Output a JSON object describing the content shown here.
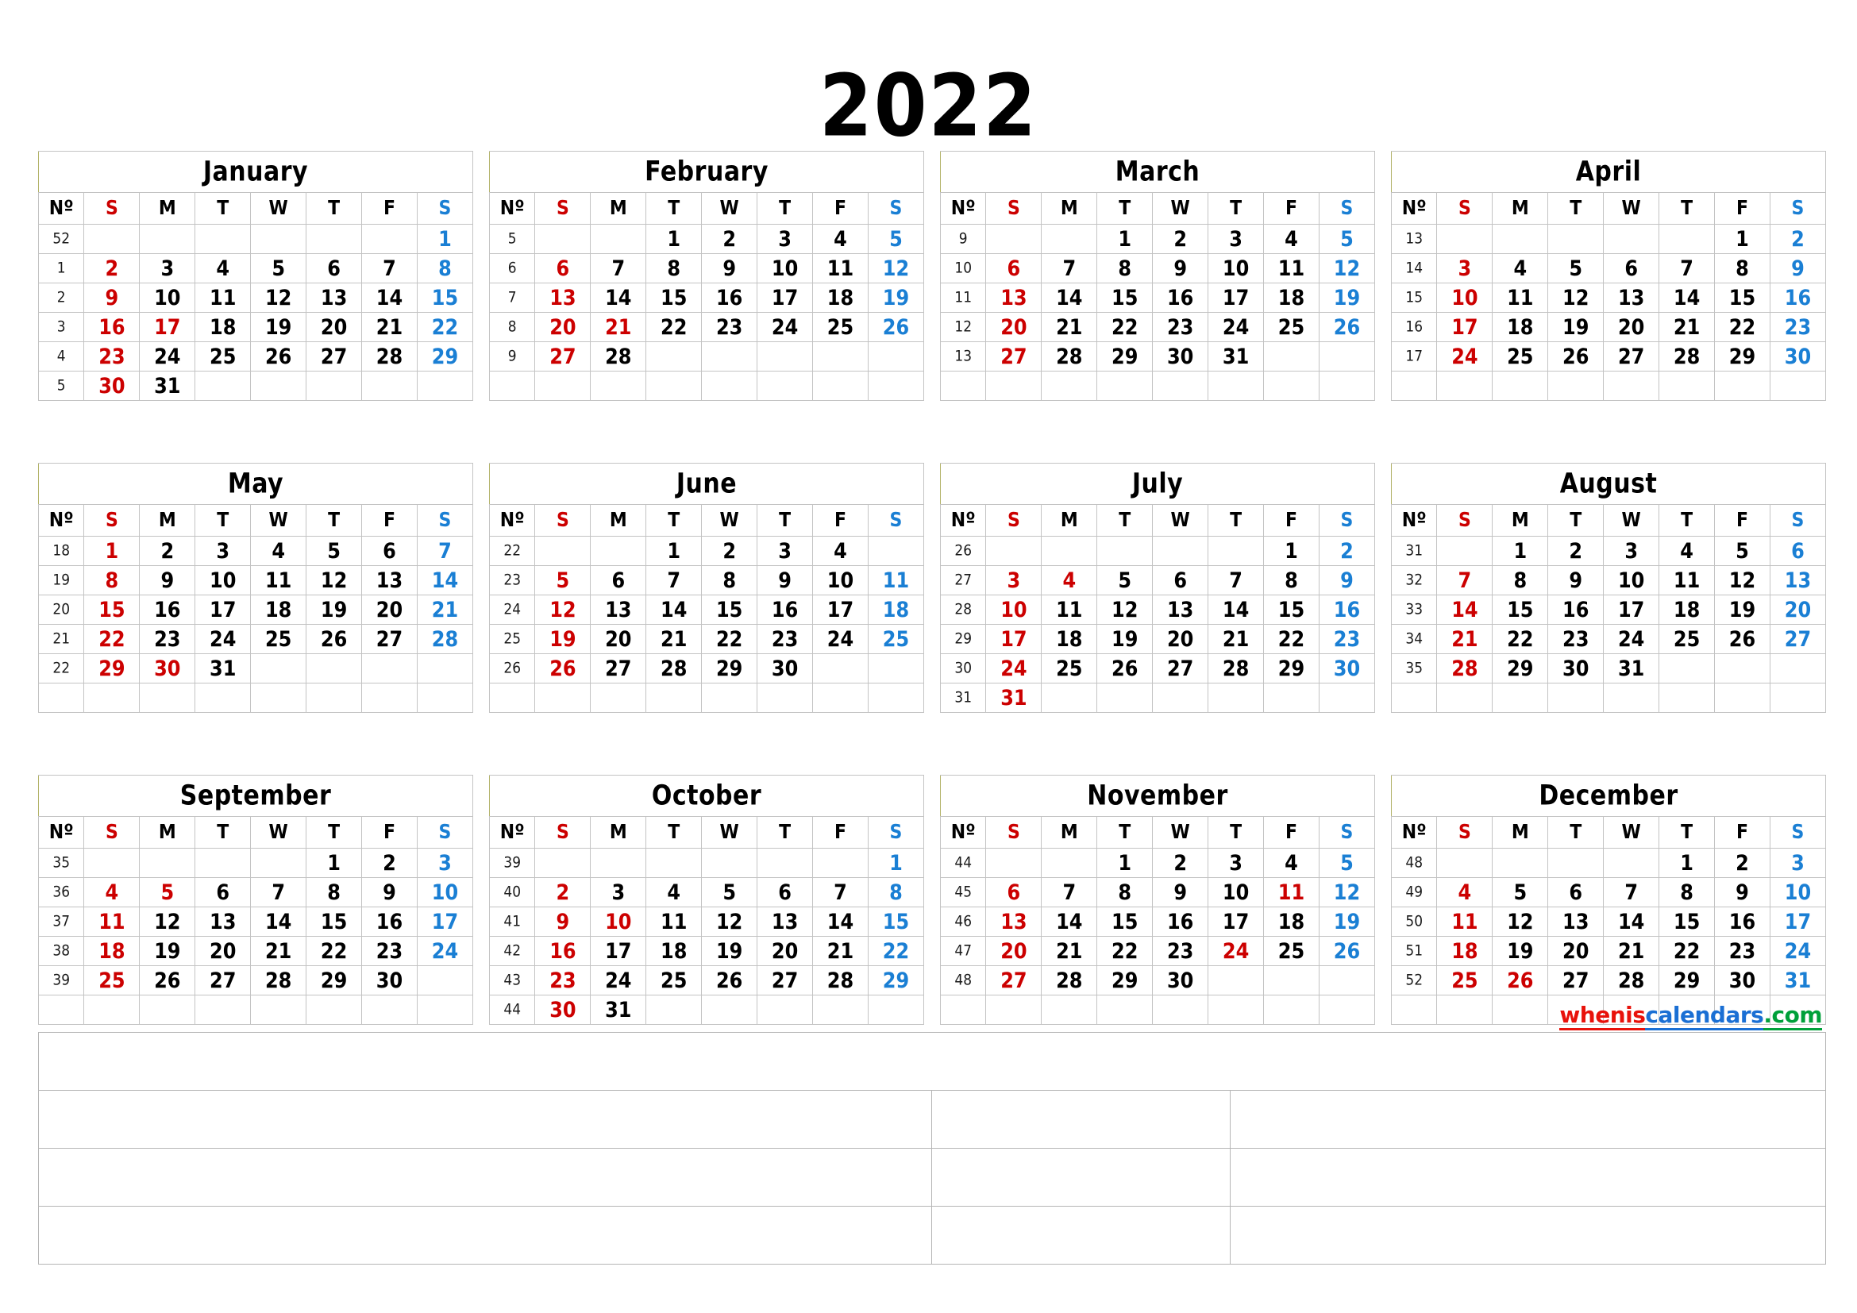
{
  "header": {
    "year": "2022"
  },
  "watermark": {
    "part1": "whenis",
    "part2": "calendars",
    "part3": ".com"
  },
  "weekday_headers": [
    "Nº",
    "S",
    "M",
    "T",
    "W",
    "T",
    "F",
    "S"
  ],
  "colors": {
    "sunday": "#cc0000",
    "saturday": "#1a7fd4",
    "holiday": "#cc0000",
    "weekday": "#000000",
    "grid": "#c3c3c3",
    "accent_left": "#b3b36a",
    "wm_red": "#e8120b",
    "wm_blue": "#1a6fd4",
    "wm_green": "#00a03a"
  },
  "notes_table": {
    "rows": 4,
    "columns_row1": 1,
    "columns_other": 3
  },
  "months": [
    {
      "name": "January",
      "weeks": [
        {
          "no": "52",
          "days": [
            "",
            "",
            "",
            "",
            "",
            "",
            "1"
          ]
        },
        {
          "no": "1",
          "days": [
            "2",
            "3",
            "4",
            "5",
            "6",
            "7",
            "8"
          ]
        },
        {
          "no": "2",
          "days": [
            "9",
            "10",
            "11",
            "12",
            "13",
            "14",
            "15"
          ]
        },
        {
          "no": "3",
          "days": [
            "16",
            "17",
            "18",
            "19",
            "20",
            "21",
            "22"
          ]
        },
        {
          "no": "4",
          "days": [
            "23",
            "24",
            "25",
            "26",
            "27",
            "28",
            "29"
          ]
        },
        {
          "no": "5",
          "days": [
            "30",
            "31",
            "",
            "",
            "",
            "",
            ""
          ]
        }
      ],
      "holidays": [
        "17"
      ]
    },
    {
      "name": "February",
      "weeks": [
        {
          "no": "5",
          "days": [
            "",
            "",
            "1",
            "2",
            "3",
            "4",
            "5"
          ]
        },
        {
          "no": "6",
          "days": [
            "6",
            "7",
            "8",
            "9",
            "10",
            "11",
            "12"
          ]
        },
        {
          "no": "7",
          "days": [
            "13",
            "14",
            "15",
            "16",
            "17",
            "18",
            "19"
          ]
        },
        {
          "no": "8",
          "days": [
            "20",
            "21",
            "22",
            "23",
            "24",
            "25",
            "26"
          ]
        },
        {
          "no": "9",
          "days": [
            "27",
            "28",
            "",
            "",
            "",
            "",
            ""
          ]
        },
        {
          "no": "",
          "days": [
            "",
            "",
            "",
            "",
            "",
            "",
            ""
          ]
        }
      ],
      "holidays": [
        "21"
      ]
    },
    {
      "name": "March",
      "weeks": [
        {
          "no": "9",
          "days": [
            "",
            "",
            "1",
            "2",
            "3",
            "4",
            "5"
          ]
        },
        {
          "no": "10",
          "days": [
            "6",
            "7",
            "8",
            "9",
            "10",
            "11",
            "12"
          ]
        },
        {
          "no": "11",
          "days": [
            "13",
            "14",
            "15",
            "16",
            "17",
            "18",
            "19"
          ]
        },
        {
          "no": "12",
          "days": [
            "20",
            "21",
            "22",
            "23",
            "24",
            "25",
            "26"
          ]
        },
        {
          "no": "13",
          "days": [
            "27",
            "28",
            "29",
            "30",
            "31",
            "",
            ""
          ]
        },
        {
          "no": "",
          "days": [
            "",
            "",
            "",
            "",
            "",
            "",
            ""
          ]
        }
      ],
      "holidays": []
    },
    {
      "name": "April",
      "weeks": [
        {
          "no": "13",
          "days": [
            "",
            "",
            "",
            "",
            "",
            "1",
            "2"
          ]
        },
        {
          "no": "14",
          "days": [
            "3",
            "4",
            "5",
            "6",
            "7",
            "8",
            "9"
          ]
        },
        {
          "no": "15",
          "days": [
            "10",
            "11",
            "12",
            "13",
            "14",
            "15",
            "16"
          ]
        },
        {
          "no": "16",
          "days": [
            "17",
            "18",
            "19",
            "20",
            "21",
            "22",
            "23"
          ]
        },
        {
          "no": "17",
          "days": [
            "24",
            "25",
            "26",
            "27",
            "28",
            "29",
            "30"
          ]
        },
        {
          "no": "",
          "days": [
            "",
            "",
            "",
            "",
            "",
            "",
            ""
          ]
        }
      ],
      "holidays": []
    },
    {
      "name": "May",
      "weeks": [
        {
          "no": "18",
          "days": [
            "1",
            "2",
            "3",
            "4",
            "5",
            "6",
            "7"
          ]
        },
        {
          "no": "19",
          "days": [
            "8",
            "9",
            "10",
            "11",
            "12",
            "13",
            "14"
          ]
        },
        {
          "no": "20",
          "days": [
            "15",
            "16",
            "17",
            "18",
            "19",
            "20",
            "21"
          ]
        },
        {
          "no": "21",
          "days": [
            "22",
            "23",
            "24",
            "25",
            "26",
            "27",
            "28"
          ]
        },
        {
          "no": "22",
          "days": [
            "29",
            "30",
            "31",
            "",
            "",
            "",
            ""
          ]
        },
        {
          "no": "",
          "days": [
            "",
            "",
            "",
            "",
            "",
            "",
            ""
          ]
        }
      ],
      "holidays": [
        "30"
      ]
    },
    {
      "name": "June",
      "weeks": [
        {
          "no": "22",
          "days": [
            "",
            "",
            "1",
            "2",
            "3",
            "4",
            ""
          ]
        },
        {
          "no": "23",
          "days": [
            "5",
            "6",
            "7",
            "8",
            "9",
            "10",
            "11"
          ]
        },
        {
          "no": "24",
          "days": [
            "12",
            "13",
            "14",
            "15",
            "16",
            "17",
            "18"
          ]
        },
        {
          "no": "25",
          "days": [
            "19",
            "20",
            "21",
            "22",
            "23",
            "24",
            "25"
          ]
        },
        {
          "no": "26",
          "days": [
            "26",
            "27",
            "28",
            "29",
            "30",
            "",
            ""
          ]
        },
        {
          "no": "",
          "days": [
            "",
            "",
            "",
            "",
            "",
            "",
            ""
          ]
        }
      ],
      "holidays": []
    },
    {
      "name": "July",
      "weeks": [
        {
          "no": "26",
          "days": [
            "",
            "",
            "",
            "",
            "",
            "1",
            "2"
          ]
        },
        {
          "no": "27",
          "days": [
            "3",
            "4",
            "5",
            "6",
            "7",
            "8",
            "9"
          ]
        },
        {
          "no": "28",
          "days": [
            "10",
            "11",
            "12",
            "13",
            "14",
            "15",
            "16"
          ]
        },
        {
          "no": "29",
          "days": [
            "17",
            "18",
            "19",
            "20",
            "21",
            "22",
            "23"
          ]
        },
        {
          "no": "30",
          "days": [
            "24",
            "25",
            "26",
            "27",
            "28",
            "29",
            "30"
          ]
        },
        {
          "no": "31",
          "days": [
            "31",
            "",
            "",
            "",
            "",
            "",
            ""
          ]
        }
      ],
      "holidays": [
        "4"
      ]
    },
    {
      "name": "August",
      "weeks": [
        {
          "no": "31",
          "days": [
            "",
            "1",
            "2",
            "3",
            "4",
            "5",
            "6"
          ]
        },
        {
          "no": "32",
          "days": [
            "7",
            "8",
            "9",
            "10",
            "11",
            "12",
            "13"
          ]
        },
        {
          "no": "33",
          "days": [
            "14",
            "15",
            "16",
            "17",
            "18",
            "19",
            "20"
          ]
        },
        {
          "no": "34",
          "days": [
            "21",
            "22",
            "23",
            "24",
            "25",
            "26",
            "27"
          ]
        },
        {
          "no": "35",
          "days": [
            "28",
            "29",
            "30",
            "31",
            "",
            "",
            ""
          ]
        },
        {
          "no": "",
          "days": [
            "",
            "",
            "",
            "",
            "",
            "",
            ""
          ]
        }
      ],
      "holidays": []
    },
    {
      "name": "September",
      "weeks": [
        {
          "no": "35",
          "days": [
            "",
            "",
            "",
            "",
            "1",
            "2",
            "3"
          ]
        },
        {
          "no": "36",
          "days": [
            "4",
            "5",
            "6",
            "7",
            "8",
            "9",
            "10"
          ]
        },
        {
          "no": "37",
          "days": [
            "11",
            "12",
            "13",
            "14",
            "15",
            "16",
            "17"
          ]
        },
        {
          "no": "38",
          "days": [
            "18",
            "19",
            "20",
            "21",
            "22",
            "23",
            "24"
          ]
        },
        {
          "no": "39",
          "days": [
            "25",
            "26",
            "27",
            "28",
            "29",
            "30",
            ""
          ]
        },
        {
          "no": "",
          "days": [
            "",
            "",
            "",
            "",
            "",
            "",
            ""
          ]
        }
      ],
      "holidays": [
        "5"
      ]
    },
    {
      "name": "October",
      "weeks": [
        {
          "no": "39",
          "days": [
            "",
            "",
            "",
            "",
            "",
            "",
            "1"
          ]
        },
        {
          "no": "40",
          "days": [
            "2",
            "3",
            "4",
            "5",
            "6",
            "7",
            "8"
          ]
        },
        {
          "no": "41",
          "days": [
            "9",
            "10",
            "11",
            "12",
            "13",
            "14",
            "15"
          ]
        },
        {
          "no": "42",
          "days": [
            "16",
            "17",
            "18",
            "19",
            "20",
            "21",
            "22"
          ]
        },
        {
          "no": "43",
          "days": [
            "23",
            "24",
            "25",
            "26",
            "27",
            "28",
            "29"
          ]
        },
        {
          "no": "44",
          "days": [
            "30",
            "31",
            "",
            "",
            "",
            "",
            ""
          ]
        }
      ],
      "holidays": [
        "10"
      ]
    },
    {
      "name": "November",
      "weeks": [
        {
          "no": "44",
          "days": [
            "",
            "",
            "1",
            "2",
            "3",
            "4",
            "5"
          ]
        },
        {
          "no": "45",
          "days": [
            "6",
            "7",
            "8",
            "9",
            "10",
            "11",
            "12"
          ]
        },
        {
          "no": "46",
          "days": [
            "13",
            "14",
            "15",
            "16",
            "17",
            "18",
            "19"
          ]
        },
        {
          "no": "47",
          "days": [
            "20",
            "21",
            "22",
            "23",
            "24",
            "25",
            "26"
          ]
        },
        {
          "no": "48",
          "days": [
            "27",
            "28",
            "29",
            "30",
            "",
            "",
            ""
          ]
        },
        {
          "no": "",
          "days": [
            "",
            "",
            "",
            "",
            "",
            "",
            ""
          ]
        }
      ],
      "holidays": [
        "11",
        "24"
      ]
    },
    {
      "name": "December",
      "weeks": [
        {
          "no": "48",
          "days": [
            "",
            "",
            "",
            "",
            "1",
            "2",
            "3"
          ]
        },
        {
          "no": "49",
          "days": [
            "4",
            "5",
            "6",
            "7",
            "8",
            "9",
            "10"
          ]
        },
        {
          "no": "50",
          "days": [
            "11",
            "12",
            "13",
            "14",
            "15",
            "16",
            "17"
          ]
        },
        {
          "no": "51",
          "days": [
            "18",
            "19",
            "20",
            "21",
            "22",
            "23",
            "24"
          ]
        },
        {
          "no": "52",
          "days": [
            "25",
            "26",
            "27",
            "28",
            "29",
            "30",
            "31"
          ]
        },
        {
          "no": "",
          "days": [
            "",
            "",
            "",
            "",
            "",
            "",
            ""
          ]
        }
      ],
      "holidays": [
        "26"
      ]
    }
  ]
}
